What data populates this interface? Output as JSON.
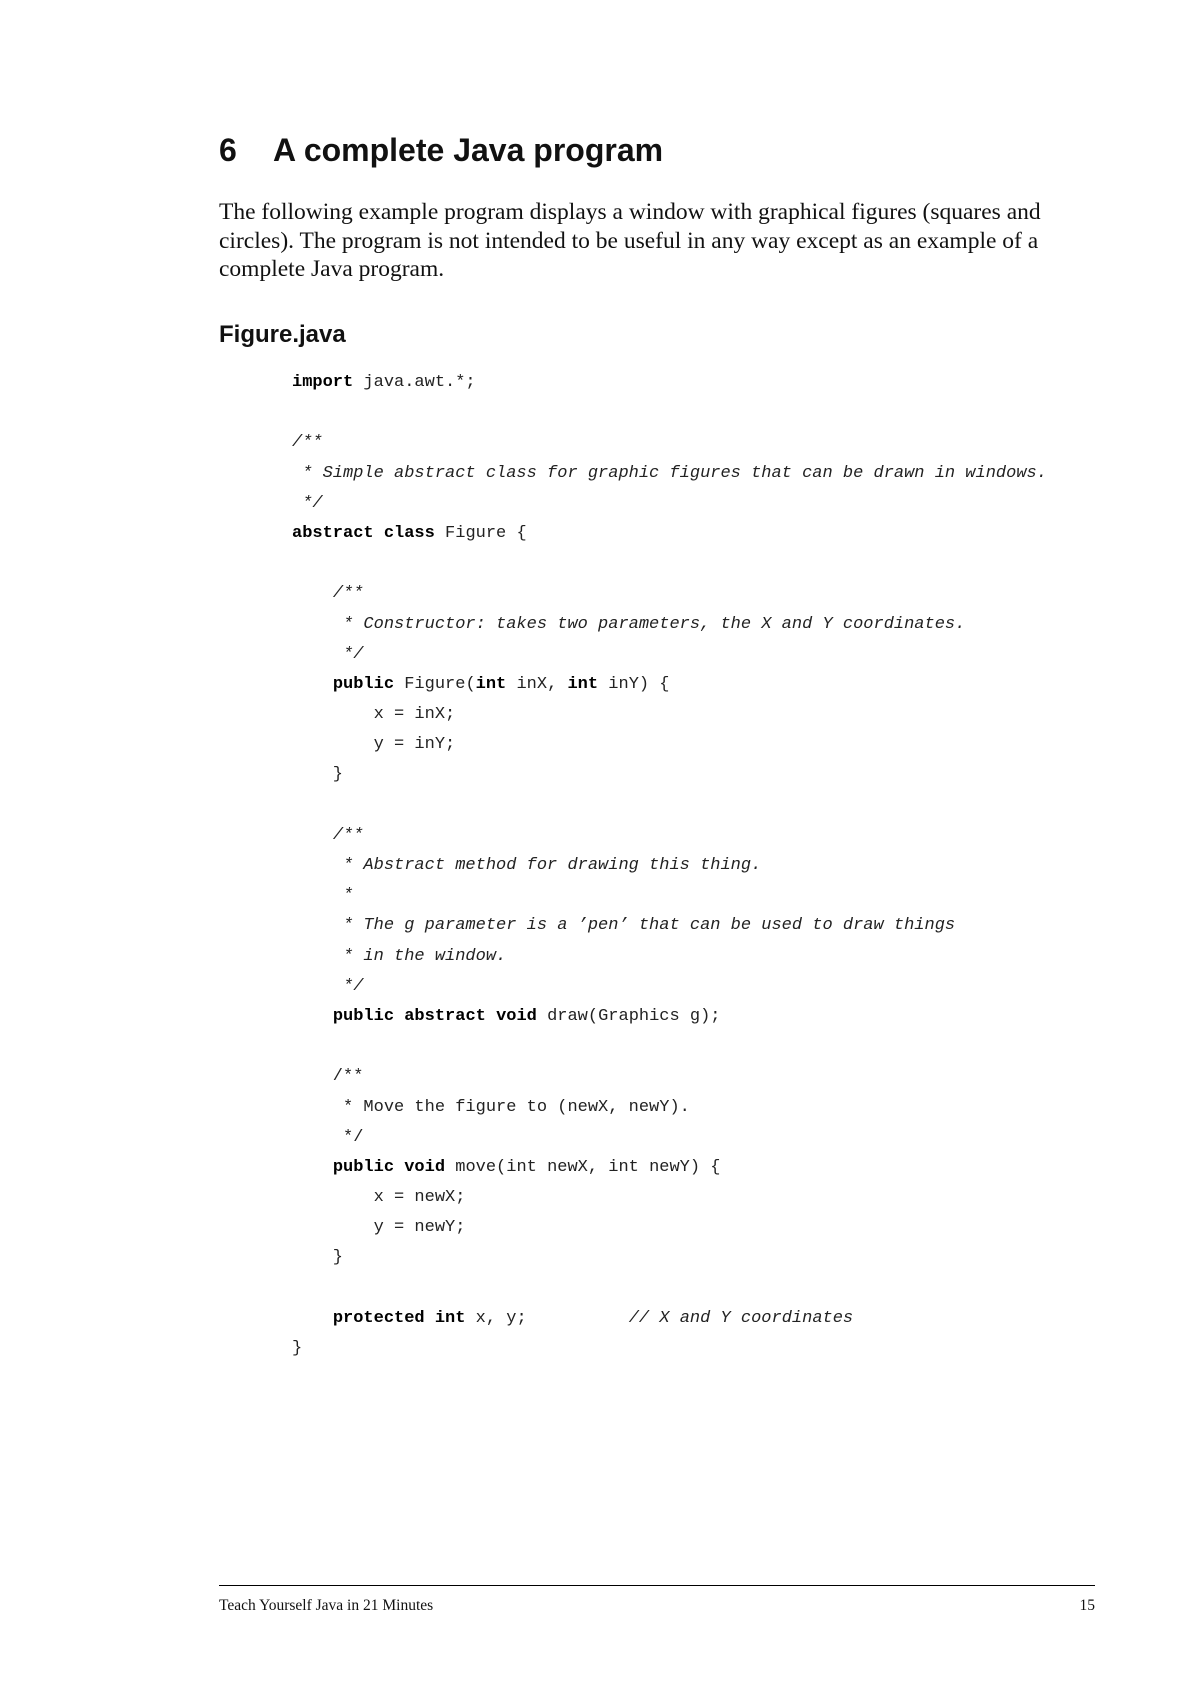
{
  "section": {
    "number": "6",
    "title": "A complete Java program",
    "intro": "The following example program displays a window with graphical figures (squares and circles). The program is not intended to be useful in any way except as an example of a complete Java program."
  },
  "file": {
    "name": "Figure.java",
    "code_lines": [
      [
        {
          "t": "import",
          "k": "kw"
        },
        {
          "t": " java.awt.*;"
        }
      ],
      [],
      [
        {
          "t": "/**",
          "k": "cm"
        }
      ],
      [
        {
          "t": " * Simple abstract class for graphic figures that can be drawn in windows.",
          "k": "cm"
        }
      ],
      [
        {
          "t": " */",
          "k": "cm"
        }
      ],
      [
        {
          "t": "abstract",
          "k": "kw"
        },
        {
          "t": " "
        },
        {
          "t": "class",
          "k": "kw"
        },
        {
          "t": " Figure {"
        }
      ],
      [],
      [
        {
          "t": "    "
        },
        {
          "t": "/**",
          "k": "cm"
        }
      ],
      [
        {
          "t": "     * Constructor: takes two parameters, the X and Y coordinates.",
          "k": "cm"
        }
      ],
      [
        {
          "t": "     */",
          "k": "cm"
        }
      ],
      [
        {
          "t": "    "
        },
        {
          "t": "public",
          "k": "kw"
        },
        {
          "t": " Figure("
        },
        {
          "t": "int",
          "k": "kw"
        },
        {
          "t": " inX, "
        },
        {
          "t": "int",
          "k": "kw"
        },
        {
          "t": " inY) {"
        }
      ],
      [
        {
          "t": "        x = inX;"
        }
      ],
      [
        {
          "t": "        y = inY;"
        }
      ],
      [
        {
          "t": "    }"
        }
      ],
      [],
      [
        {
          "t": "    "
        },
        {
          "t": "/**",
          "k": "cm"
        }
      ],
      [
        {
          "t": "     * Abstract method for drawing this thing.",
          "k": "cm"
        }
      ],
      [
        {
          "t": "     *",
          "k": "cm"
        }
      ],
      [
        {
          "t": "     * The g parameter is a ’pen’ that can be used to draw things",
          "k": "cm"
        }
      ],
      [
        {
          "t": "     * in the window.",
          "k": "cm"
        }
      ],
      [
        {
          "t": "     */",
          "k": "cm"
        }
      ],
      [
        {
          "t": "    "
        },
        {
          "t": "public",
          "k": "kw"
        },
        {
          "t": " "
        },
        {
          "t": "abstract",
          "k": "kw"
        },
        {
          "t": " "
        },
        {
          "t": "void",
          "k": "kw"
        },
        {
          "t": " draw(Graphics g);"
        }
      ],
      [],
      [
        {
          "t": "    /**"
        }
      ],
      [
        {
          "t": "     * Move the figure to (newX, newY)."
        }
      ],
      [
        {
          "t": "     */"
        }
      ],
      [
        {
          "t": "    "
        },
        {
          "t": "public",
          "k": "kw"
        },
        {
          "t": " "
        },
        {
          "t": "void",
          "k": "kw"
        },
        {
          "t": " move(int newX, int newY) {"
        }
      ],
      [
        {
          "t": "        x = newX;"
        }
      ],
      [
        {
          "t": "        y = newY;"
        }
      ],
      [
        {
          "t": "    }"
        }
      ],
      [],
      [
        {
          "t": "    "
        },
        {
          "t": "protected",
          "k": "kw"
        },
        {
          "t": " "
        },
        {
          "t": "int",
          "k": "kw"
        },
        {
          "t": " x, y;          "
        },
        {
          "t": "// X and Y coordinates",
          "k": "cm"
        }
      ],
      [
        {
          "t": "}"
        }
      ]
    ]
  },
  "footer": {
    "book_title": "Teach Yourself Java in 21 Minutes",
    "page_number": "15"
  }
}
